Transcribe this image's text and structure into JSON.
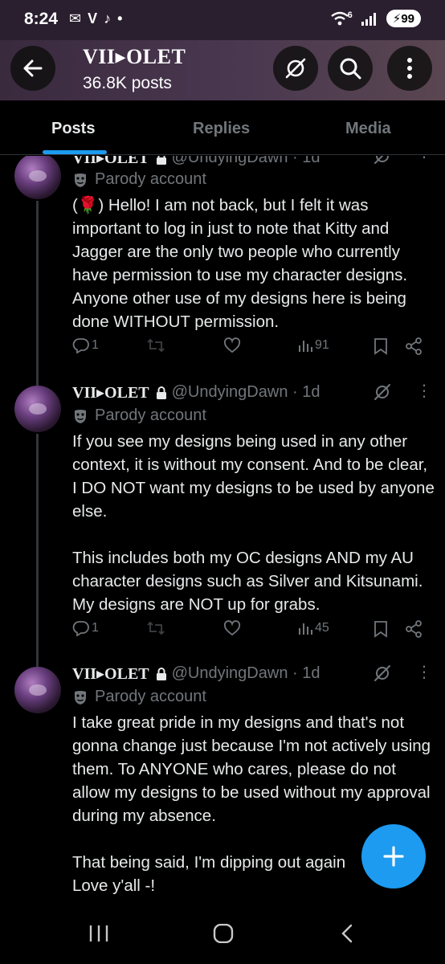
{
  "status_bar": {
    "time": "8:24",
    "left_glyphs": [
      "✉",
      "V",
      "♪",
      "•"
    ],
    "network": "6",
    "battery": "99"
  },
  "header": {
    "name": "VII▸OLET",
    "post_count": "36.8K posts"
  },
  "tabs": [
    {
      "label": "Posts",
      "active": true
    },
    {
      "label": "Replies",
      "active": false
    },
    {
      "label": "Media",
      "active": false
    }
  ],
  "posts": [
    {
      "name": "VII▸OLET",
      "handle": "@UndyingDawn · 1d",
      "parody_label": "Parody account",
      "text": "(🌹) Hello! I am not back, but I felt it was important to log in just to note that Kitty and Jagger are the only two people who currently have permission to use my character designs. Anyone other use of my designs here is being done WITHOUT permission.",
      "replies": "1",
      "views": "91"
    },
    {
      "name": "VII▸OLET",
      "handle": "@UndyingDawn · 1d",
      "parody_label": "Parody account",
      "text": "If you see my designs being used in any other context, it is without my consent. And to be clear, I DO NOT want my designs to be used by anyone else.\n\nThis includes both my OC designs AND my AU character designs such as Silver and Kitsunami. My designs are NOT up for grabs.",
      "replies": "1",
      "views": "45"
    },
    {
      "name": "VII▸OLET",
      "handle": "@UndyingDawn · 1d",
      "parody_label": "Parody account",
      "text": "I take great pride in my designs and that's not gonna change just because I'm not actively using them. To ANYONE who cares, please do not allow my designs to be used without my approval during my absence.\n\nThat being said, I'm dipping out again\nLove y'all -!"
    }
  ],
  "colors": {
    "accent": "#1d9bf0",
    "muted": "#71767b",
    "text": "#e7e9ea"
  }
}
